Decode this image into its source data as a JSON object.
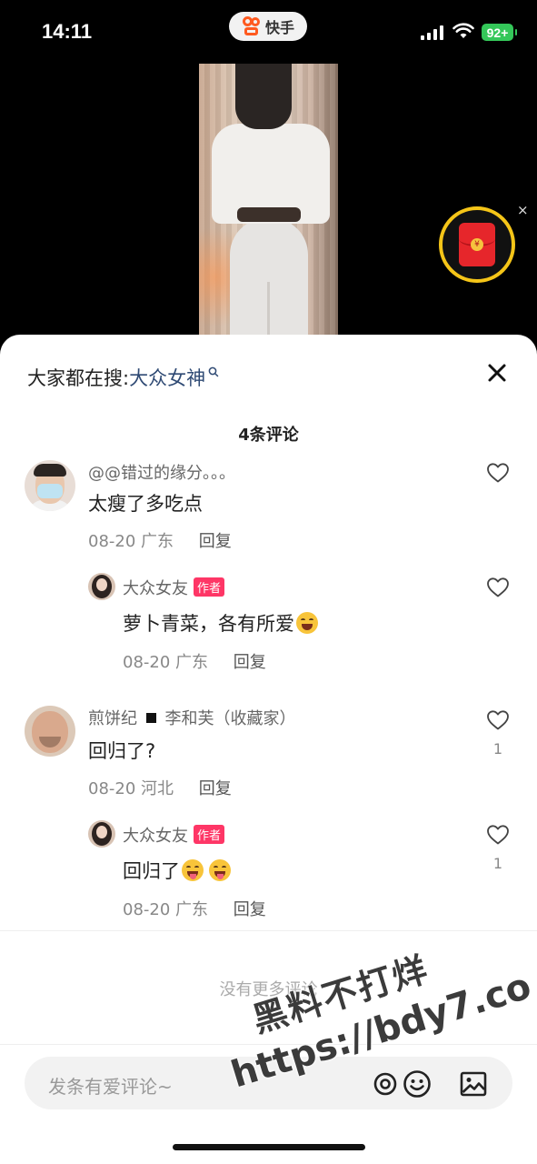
{
  "status_bar": {
    "time": "14:11",
    "app_name": "快手",
    "battery": "92+"
  },
  "colors": {
    "accent_red": "#fe3666",
    "search_term": "#2f4a74",
    "battery_green": "#34c759",
    "ring_gold": "#f5c518"
  },
  "overlay": {
    "redpacket_icon": "red-envelope-icon",
    "close_glyph": "×"
  },
  "sheet": {
    "search_prefix": "大家都在搜:",
    "search_term": "大众女神",
    "comment_count": "4条评论"
  },
  "comments": [
    {
      "username": "@@错过的缘分。。。",
      "text": "太瘦了多吃点",
      "date": "08-20",
      "location": "广东",
      "reply_label": "回复",
      "likes": ""
    },
    {
      "username": "大众女友",
      "badge": "作者",
      "text": "萝卜青菜，各有所爱",
      "emoji": "laughing-tears-emoji",
      "date": "08-20",
      "location": "广东",
      "reply_label": "回复",
      "likes": ""
    },
    {
      "username": "煎饼纪",
      "username_rest": "李和芙（收藏家）",
      "text": "回归了?",
      "date": "08-20",
      "location": "河北",
      "reply_label": "回复",
      "likes": "1"
    },
    {
      "username": "大众女友",
      "badge": "作者",
      "text": "回归了",
      "emoji": "winking-tongue-emoji",
      "date": "08-20",
      "location": "广东",
      "reply_label": "回复",
      "likes": "1"
    }
  ],
  "footer": {
    "no_more": "没有更多评论",
    "input_placeholder": "发条有爱评论~"
  },
  "watermark": {
    "line1": "黑料不打烊",
    "line2": "https://bdy7.co"
  }
}
